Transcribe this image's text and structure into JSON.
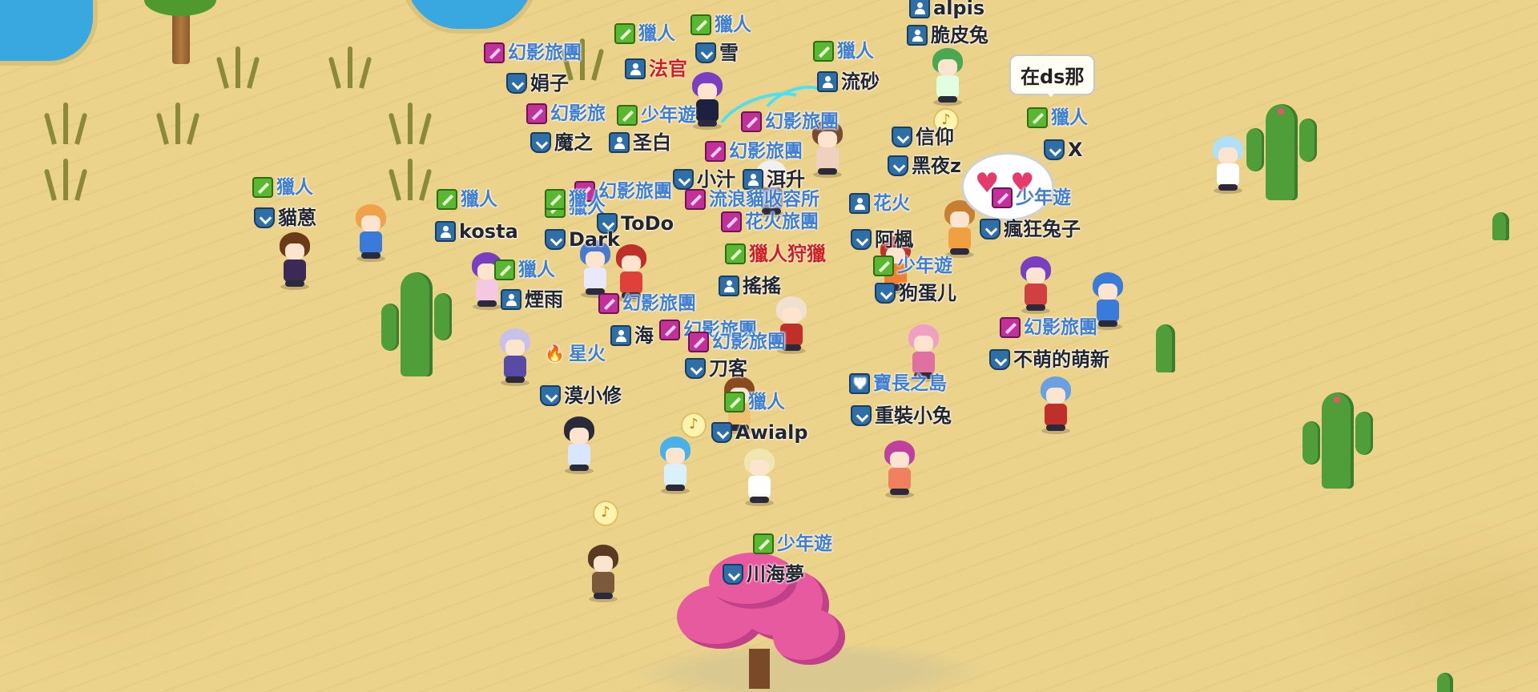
{
  "bubble_text": "在ds那",
  "tags": [
    {
      "id": "t1",
      "kind": "guild",
      "icon": "sword",
      "text": "獵人"
    },
    {
      "id": "t2",
      "kind": "guild",
      "icon": "sword",
      "text": "獵人"
    },
    {
      "id": "t3",
      "kind": "name",
      "icon": "shield",
      "text": "雪"
    },
    {
      "id": "t4",
      "kind": "guild",
      "icon": "staff",
      "text": "幻影旅團"
    },
    {
      "id": "t5",
      "kind": "name",
      "icon": "shield",
      "text": "娟子"
    },
    {
      "id": "t6",
      "kind": "red",
      "icon": "person",
      "text": "法官"
    },
    {
      "id": "t7",
      "kind": "guild",
      "icon": "staff",
      "text": "幻影旅"
    },
    {
      "id": "t8",
      "kind": "guild",
      "icon": "sword",
      "text": "少年遊"
    },
    {
      "id": "t9",
      "kind": "name",
      "icon": "shield",
      "text": "魔之"
    },
    {
      "id": "t10",
      "kind": "name",
      "icon": "person",
      "text": "圣白"
    },
    {
      "id": "t11",
      "kind": "guild",
      "icon": "staff",
      "text": "幻影旅團"
    },
    {
      "id": "t12",
      "kind": "guild",
      "icon": "staff",
      "text": "幻影旅團"
    },
    {
      "id": "t13",
      "kind": "name",
      "icon": "shield",
      "text": "小汁"
    },
    {
      "id": "t14",
      "kind": "name",
      "icon": "person",
      "text": "洱升"
    },
    {
      "id": "t15",
      "kind": "guild",
      "icon": "staff",
      "text": "幻影旅團"
    },
    {
      "id": "t16",
      "kind": "guild",
      "icon": "sword",
      "text": "獵人"
    },
    {
      "id": "t17",
      "kind": "name",
      "icon": "shield",
      "text": "ToDo"
    },
    {
      "id": "t18",
      "kind": "guild",
      "icon": "staff",
      "text": "流浪貓收容所"
    },
    {
      "id": "t19",
      "kind": "guild",
      "icon": "sword",
      "text": "獵人"
    },
    {
      "id": "t20",
      "kind": "name",
      "icon": "person",
      "text": "流砂"
    },
    {
      "id": "t21",
      "kind": "name",
      "icon": "person",
      "text": "脆皮兔"
    },
    {
      "id": "t22",
      "kind": "name",
      "icon": "shield",
      "text": "信仰"
    },
    {
      "id": "t23",
      "kind": "name",
      "icon": "shield",
      "text": "黑夜z"
    },
    {
      "id": "t24",
      "kind": "guild",
      "icon": "sword",
      "text": "獵人"
    },
    {
      "id": "t25",
      "kind": "name",
      "icon": "shield",
      "text": "X"
    },
    {
      "id": "t26",
      "kind": "guild",
      "icon": "sword",
      "text": "獵人"
    },
    {
      "id": "t27",
      "kind": "name",
      "icon": "shield",
      "text": "貓蒽"
    },
    {
      "id": "t28",
      "kind": "guild",
      "icon": "sword",
      "text": "獵人"
    },
    {
      "id": "t29",
      "kind": "name",
      "icon": "person",
      "text": "kosta"
    },
    {
      "id": "t30",
      "kind": "guild",
      "icon": "sword",
      "text": "獵人"
    },
    {
      "id": "t31",
      "kind": "name",
      "icon": "shield",
      "text": "Dark"
    },
    {
      "id": "t32",
      "kind": "guild",
      "icon": "sword",
      "text": "獵人"
    },
    {
      "id": "t33",
      "kind": "name",
      "icon": "person",
      "text": "煙雨"
    },
    {
      "id": "t34",
      "kind": "guild",
      "icon": "staff",
      "text": "幻影旅團"
    },
    {
      "id": "t35",
      "kind": "guild",
      "icon": "staff",
      "text": "花火旅團"
    },
    {
      "id": "t36",
      "kind": "red",
      "icon": "sword",
      "text": "獵人狩獵"
    },
    {
      "id": "t37",
      "kind": "name",
      "icon": "person",
      "text": "搖搖"
    },
    {
      "id": "t38",
      "kind": "guild",
      "icon": "person",
      "text": "花火"
    },
    {
      "id": "t39",
      "kind": "name",
      "icon": "shield",
      "text": "阿楓"
    },
    {
      "id": "t40",
      "kind": "guild",
      "icon": "sword",
      "text": "少年遊"
    },
    {
      "id": "t41",
      "kind": "name",
      "icon": "shield",
      "text": "狗蛋儿"
    },
    {
      "id": "t42",
      "kind": "guild",
      "icon": "staff",
      "text": "少年遊"
    },
    {
      "id": "t43",
      "kind": "name",
      "icon": "shield",
      "text": "瘋狂兔子"
    },
    {
      "id": "t44",
      "kind": "name",
      "icon": "person",
      "text": "海"
    },
    {
      "id": "t45",
      "kind": "guild",
      "icon": "staff",
      "text": "幻影旅團"
    },
    {
      "id": "t46",
      "kind": "guild",
      "icon": "staff",
      "text": "幻影旅團"
    },
    {
      "id": "t47",
      "kind": "name",
      "icon": "shield",
      "text": "刀客"
    },
    {
      "id": "t48",
      "kind": "guild",
      "icon": "fire",
      "text": "星火"
    },
    {
      "id": "t49",
      "kind": "name",
      "icon": "shield",
      "text": "漠小修"
    },
    {
      "id": "t50",
      "kind": "guild",
      "icon": "staff",
      "text": "幻影旅團"
    },
    {
      "id": "t51",
      "kind": "name",
      "icon": "shield",
      "text": "不萌的萌新"
    },
    {
      "id": "t52",
      "kind": "guild",
      "icon": "trident",
      "text": "寶長之島"
    },
    {
      "id": "t53",
      "kind": "name",
      "icon": "shield",
      "text": "重裝小兔"
    },
    {
      "id": "t54",
      "kind": "guild",
      "icon": "sword",
      "text": "獵人"
    },
    {
      "id": "t55",
      "kind": "name",
      "icon": "shield",
      "text": "Awialp"
    },
    {
      "id": "t56",
      "kind": "guild",
      "icon": "sword",
      "text": "少年遊"
    },
    {
      "id": "t57",
      "kind": "name",
      "icon": "shield",
      "text": "川海夢"
    },
    {
      "id": "t58",
      "kind": "name",
      "icon": "person",
      "text": "alpis"
    }
  ]
}
